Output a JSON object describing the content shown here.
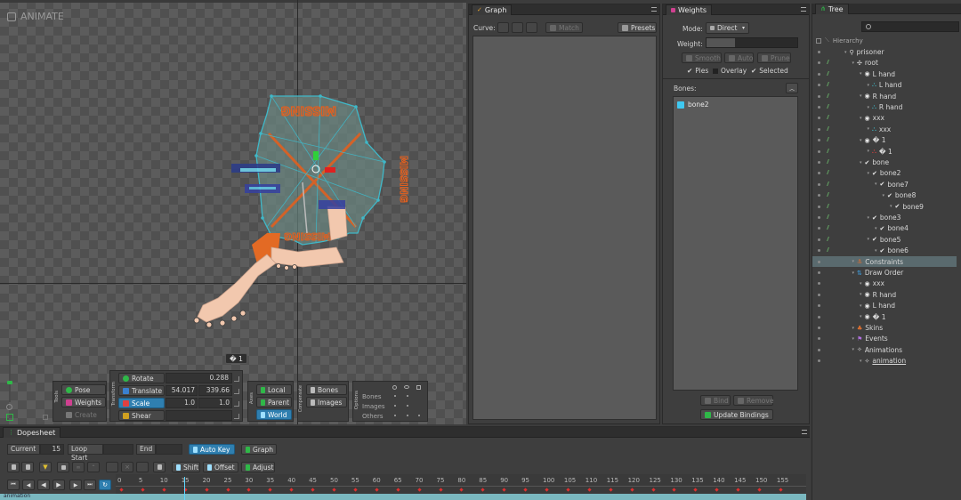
{
  "viewport": {
    "title": "ANIMATE",
    "slot_badge": "� 1"
  },
  "tools": {
    "label": "Tools",
    "pose": "Pose",
    "weights": "Weights",
    "create": "Create"
  },
  "transform": {
    "label": "Transform",
    "rotate_label": "Rotate",
    "rotate_value": "0.288",
    "translate_label": "Translate",
    "translate_x": "54.017",
    "translate_y": "339.66",
    "scale_label": "Scale",
    "scale_x": "1.0",
    "scale_y": "1.0",
    "shear_label": "Shear"
  },
  "axes": {
    "label": "Axes",
    "local": "Local",
    "parent": "Parent",
    "world": "World"
  },
  "compensate": {
    "label": "Compensate",
    "bones": "Bones",
    "images": "Images"
  },
  "options": {
    "label": "Options",
    "rows": [
      "Bones",
      "Images",
      "Others"
    ]
  },
  "graph": {
    "tab": "Graph",
    "curve_label": "Curve:",
    "match": "Match",
    "presets": "Presets"
  },
  "weights": {
    "tab": "Weights",
    "mode_label": "Mode:",
    "mode_value": "Direct",
    "weight_label": "Weight:",
    "smooth": "Smooth",
    "auto": "Auto",
    "prune": "Prune",
    "pies": "Pies",
    "overlay": "Overlay",
    "selected": "Selected",
    "bones_label": "Bones:",
    "bone_item": "bone2",
    "bind": "Bind",
    "remove": "Remove",
    "update_bindings": "Update Bindings"
  },
  "tree": {
    "tab": "Tree",
    "hierarchy": "Hierarchy",
    "items": [
      {
        "label": "prisoner",
        "depth": 0,
        "icon": "skeleton-icon",
        "vis": false
      },
      {
        "label": "root",
        "depth": 1,
        "icon": "bone-root-icon",
        "vis": true
      },
      {
        "label": "L hand",
        "depth": 2,
        "icon": "slot-icon",
        "vis": true
      },
      {
        "label": "L hand",
        "depth": 3,
        "icon": "mesh-icon",
        "vis": true
      },
      {
        "label": "R hand",
        "depth": 2,
        "icon": "slot-icon",
        "vis": true
      },
      {
        "label": "R hand",
        "depth": 3,
        "icon": "mesh-icon",
        "vis": true
      },
      {
        "label": "xxx",
        "depth": 2,
        "icon": "slot-icon",
        "vis": true
      },
      {
        "label": "xxx",
        "depth": 3,
        "icon": "mesh-icon",
        "vis": true
      },
      {
        "label": "� 1",
        "depth": 2,
        "icon": "slot-icon",
        "vis": true
      },
      {
        "label": "� 1",
        "depth": 3,
        "icon": "mesh-colored-icon",
        "vis": true
      },
      {
        "label": "bone",
        "depth": 2,
        "icon": "bone-icon",
        "vis": true
      },
      {
        "label": "bone2",
        "depth": 3,
        "icon": "bone-icon",
        "vis": true
      },
      {
        "label": "bone7",
        "depth": 4,
        "icon": "bone-icon",
        "vis": true
      },
      {
        "label": "bone8",
        "depth": 5,
        "icon": "bone-icon",
        "vis": true
      },
      {
        "label": "bone9",
        "depth": 6,
        "icon": "bone-icon",
        "vis": true
      },
      {
        "label": "bone3",
        "depth": 3,
        "icon": "bone-icon",
        "vis": true
      },
      {
        "label": "bone4",
        "depth": 4,
        "icon": "bone-icon",
        "vis": true
      },
      {
        "label": "bone5",
        "depth": 3,
        "icon": "bone-icon",
        "vis": true
      },
      {
        "label": "bone6",
        "depth": 4,
        "icon": "bone-icon",
        "vis": true
      },
      {
        "label": "Constraints",
        "depth": 1,
        "icon": "constraints-icon",
        "vis": false,
        "highlight": true
      },
      {
        "label": "Draw Order",
        "depth": 1,
        "icon": "draw-order-icon",
        "vis": false
      },
      {
        "label": "xxx",
        "depth": 2,
        "icon": "slot-icon",
        "vis": false
      },
      {
        "label": "R hand",
        "depth": 2,
        "icon": "slot-icon",
        "vis": false
      },
      {
        "label": "L hand",
        "depth": 2,
        "icon": "slot-icon",
        "vis": false
      },
      {
        "label": "� 1",
        "depth": 2,
        "icon": "slot-icon",
        "vis": false
      },
      {
        "label": "Skins",
        "depth": 1,
        "icon": "skins-icon",
        "vis": false
      },
      {
        "label": "Events",
        "depth": 1,
        "icon": "events-icon",
        "vis": false
      },
      {
        "label": "Animations",
        "depth": 1,
        "icon": "animations-icon",
        "vis": false
      },
      {
        "label": "animation",
        "depth": 2,
        "icon": "animation-icon",
        "vis": false
      }
    ]
  },
  "dopesheet": {
    "tab": "Dopesheet",
    "current_label": "Current",
    "current_value": "15",
    "loop_start": "Loop Start",
    "end": "End",
    "auto_key": "Auto Key",
    "graph": "Graph",
    "shift": "Shift",
    "offset": "Offset",
    "adjust": "Adjust",
    "ticks": [
      "0",
      "5",
      "10",
      "15",
      "20",
      "25",
      "30",
      "35",
      "40",
      "45",
      "50",
      "55",
      "60",
      "65",
      "70",
      "75",
      "80",
      "85",
      "90",
      "95",
      "100",
      "105",
      "110",
      "115",
      "120",
      "125",
      "130",
      "135",
      "140",
      "145",
      "150",
      "155"
    ],
    "track": "animation"
  },
  "colors": {
    "accent": "#2f7fb0",
    "mesh": "#3fb8c8",
    "selection": "#2fa0e0"
  }
}
